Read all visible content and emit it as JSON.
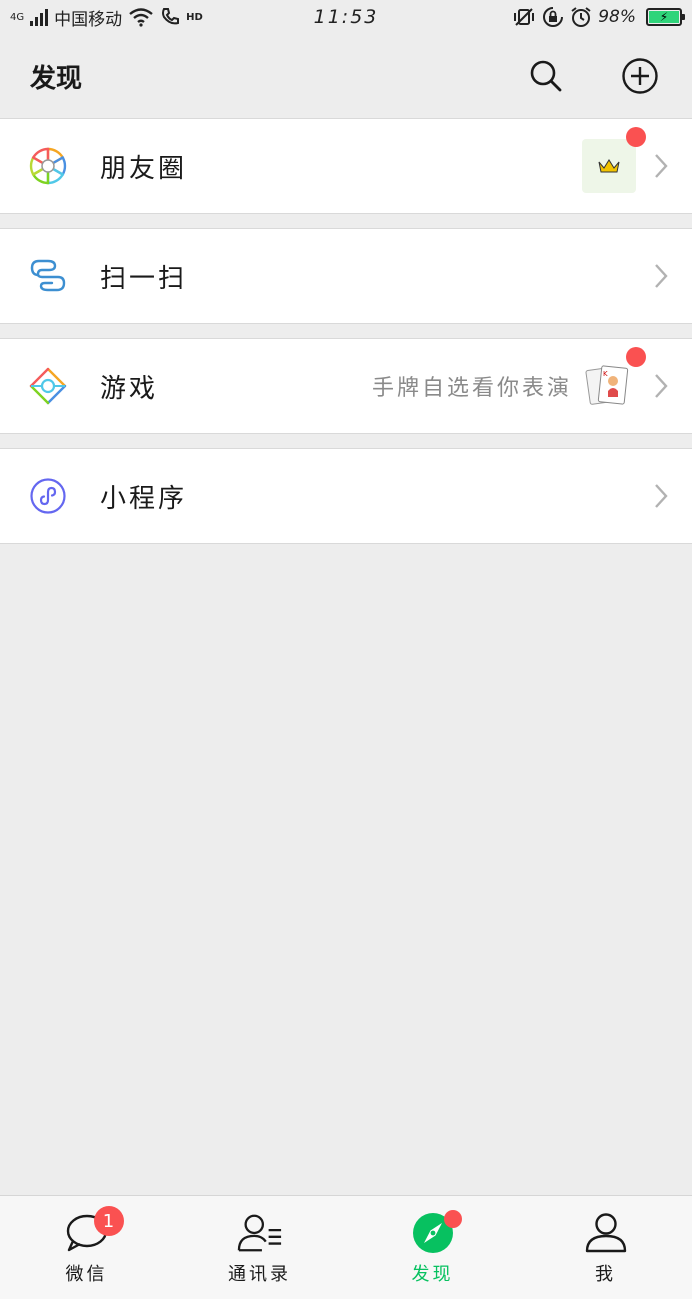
{
  "status_bar": {
    "network": "4G",
    "carrier": "中国移动",
    "hd": "HD",
    "time": "11:53",
    "battery": "98%"
  },
  "header": {
    "title": "发现"
  },
  "cells": [
    {
      "label": "朋友圈",
      "subtitle": "",
      "icon": "moments-icon"
    },
    {
      "label": "扫一扫",
      "subtitle": "",
      "icon": "scan-icon"
    },
    {
      "label": "游戏",
      "subtitle": "手牌自选看你表演",
      "icon": "games-icon"
    },
    {
      "label": "小程序",
      "subtitle": "",
      "icon": "mini-program-icon"
    }
  ],
  "tabbar": {
    "tabs": [
      {
        "label": "微信",
        "badge": "1"
      },
      {
        "label": "通讯录"
      },
      {
        "label": "发现"
      },
      {
        "label": "我"
      }
    ]
  },
  "colors": {
    "accent": "#07c160",
    "badge": "#fa5151",
    "background": "#ededed"
  }
}
